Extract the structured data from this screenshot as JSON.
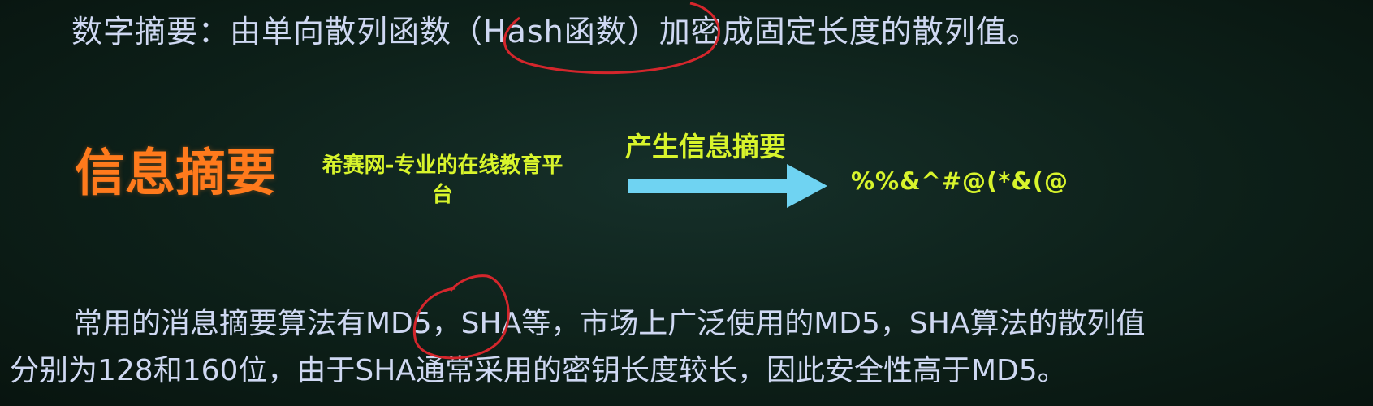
{
  "slide": {
    "definition": "数字摘要：由单向散列函数（Hash函数）加密成固定长度的散列值。",
    "title": "信息摘要",
    "source_text": "希赛网-专业的在线教育平台",
    "arrow_label": "产生信息摘要",
    "digest_value": "%%&^#@(*&(@",
    "paragraph_line1": "常用的消息摘要算法有MD5，SHA等，市场上广泛使用的MD5，SHA算法的散列值",
    "paragraph_line2": "分别为128和160位，由于SHA通常采用的密钥长度较长，因此安全性高于MD5。"
  },
  "colors": {
    "background": "#0d2019",
    "body_text": "#cfd8f2",
    "title": "#ff7a1c",
    "highlight": "#d8f42c",
    "arrow": "#6fd3f2",
    "annotation": "#d4262c"
  }
}
